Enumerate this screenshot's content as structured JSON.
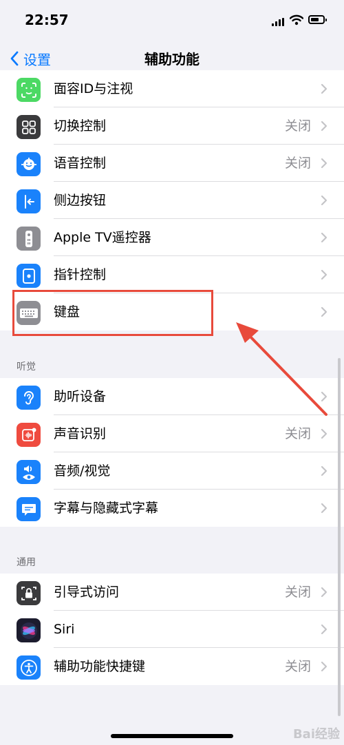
{
  "status_bar": {
    "time": "22:57"
  },
  "nav": {
    "back_label": "设置",
    "title": "辅助功能"
  },
  "rows_top": [
    {
      "label": "面容ID与注视",
      "value": "",
      "icon": "face-id-icon",
      "color": "#4cd964"
    },
    {
      "label": "切换控制",
      "value": "关闭",
      "icon": "switch-control-icon",
      "color": "#3a3a3c"
    },
    {
      "label": "语音控制",
      "value": "关闭",
      "icon": "voice-control-icon",
      "color": "#1a82fb"
    },
    {
      "label": "侧边按钮",
      "value": "",
      "icon": "side-button-icon",
      "color": "#1a82fb"
    },
    {
      "label": "Apple TV遥控器",
      "value": "",
      "icon": "remote-icon",
      "color": "#8e8e93"
    },
    {
      "label": "指针控制",
      "value": "",
      "icon": "pointer-control-icon",
      "color": "#1a82fb"
    },
    {
      "label": "键盘",
      "value": "",
      "icon": "keyboard-icon",
      "color": "#8e8e93"
    }
  ],
  "hearing": {
    "header": "听觉",
    "rows": [
      {
        "label": "助听设备",
        "value": "",
        "icon": "ear-icon",
        "color": "#1a82fb"
      },
      {
        "label": "声音识别",
        "value": "关闭",
        "icon": "sound-recognition-icon",
        "color": "#ef4b3f"
      },
      {
        "label": "音频/视觉",
        "value": "",
        "icon": "audio-visual-icon",
        "color": "#1a82fb"
      },
      {
        "label": "字幕与隐藏式字幕",
        "value": "",
        "icon": "subtitles-icon",
        "color": "#1a82fb"
      }
    ]
  },
  "general": {
    "header": "通用",
    "rows": [
      {
        "label": "引导式访问",
        "value": "关闭",
        "icon": "lock-icon",
        "color": "#3a3a3c"
      },
      {
        "label": "Siri",
        "value": "",
        "icon": "siri-icon",
        "color": "#1c1c2e"
      },
      {
        "label": "辅助功能快捷键",
        "value": "关闭",
        "icon": "accessibility-icon",
        "color": "#1a82fb"
      }
    ]
  },
  "watermark": "Bai经验"
}
